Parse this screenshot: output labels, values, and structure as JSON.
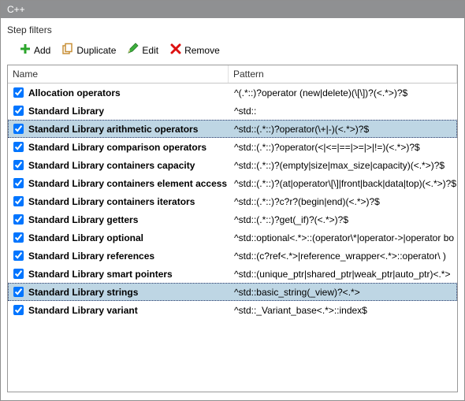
{
  "titlebar": {
    "title": "C++"
  },
  "subtitle": "Step filters",
  "toolbar": {
    "add_label": "Add",
    "duplicate_label": "Duplicate",
    "edit_label": "Edit",
    "remove_label": "Remove"
  },
  "table": {
    "headers": {
      "name": "Name",
      "pattern": "Pattern"
    },
    "rows": [
      {
        "checked": true,
        "selected": false,
        "name": "Allocation operators",
        "pattern": "^(.*::)?operator (new|delete)(\\[\\])?(<.*>)?$"
      },
      {
        "checked": true,
        "selected": false,
        "name": "Standard Library",
        "pattern": "^std::"
      },
      {
        "checked": true,
        "selected": true,
        "name": "Standard Library arithmetic operators",
        "pattern": "^std::(.*::)?operator(\\+|-)(<.*>)?$"
      },
      {
        "checked": true,
        "selected": false,
        "name": "Standard Library comparison operators",
        "pattern": "^std::(.*::)?operator(<|<=|==|>=|>|!=)(<.*>)?$"
      },
      {
        "checked": true,
        "selected": false,
        "name": "Standard Library containers capacity",
        "pattern": "^std::(.*::)?(empty|size|max_size|capacity)(<.*>)?$"
      },
      {
        "checked": true,
        "selected": false,
        "name": "Standard Library containers element access",
        "pattern": "^std::(.*::)?(at|operator\\[\\]|front|back|data|top)(<.*>)?$"
      },
      {
        "checked": true,
        "selected": false,
        "name": "Standard Library containers iterators",
        "pattern": "^std::(.*::)?c?r?(begin|end)(<.*>)?$"
      },
      {
        "checked": true,
        "selected": false,
        "name": "Standard Library getters",
        "pattern": "^std::(.*::)?get(_if)?(<.*>)?$"
      },
      {
        "checked": true,
        "selected": false,
        "name": "Standard Library optional",
        "pattern": "^std::optional<.*>::(operator\\*|operator->|operator bo"
      },
      {
        "checked": true,
        "selected": false,
        "name": "Standard Library references",
        "pattern": "^std::(c?ref<.*>|reference_wrapper<.*>::operator\\ )"
      },
      {
        "checked": true,
        "selected": false,
        "name": "Standard Library smart pointers",
        "pattern": "^std::(unique_ptr|shared_ptr|weak_ptr|auto_ptr)<.*>"
      },
      {
        "checked": true,
        "selected": true,
        "name": "Standard Library strings",
        "pattern": "^std::basic_string(_view)?<.*>"
      },
      {
        "checked": true,
        "selected": false,
        "name": "Standard Library variant",
        "pattern": "^std::_Variant_base<.*>::index$"
      }
    ]
  }
}
